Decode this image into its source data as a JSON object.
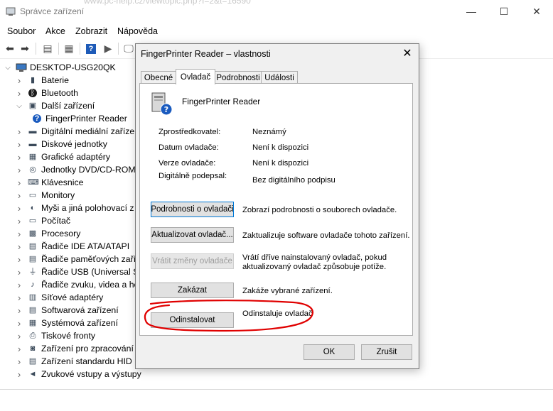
{
  "window": {
    "title": "Správce zařízení",
    "ghost_url": "www.pc-help.cz/viewtopic.php?f=2&t=16590"
  },
  "menu": [
    "Soubor",
    "Akce",
    "Zobrazit",
    "Nápověda"
  ],
  "tree": {
    "root": "DESKTOP-USG20QK",
    "items": [
      {
        "label": "Baterie",
        "icon": "battery-icon",
        "expanded": false
      },
      {
        "label": "Bluetooth",
        "icon": "bluetooth-icon",
        "expanded": false
      },
      {
        "label": "Další zařízení",
        "icon": "other-devices-icon",
        "expanded": true
      },
      {
        "label": "FingerPrinter Reader",
        "icon": "unknown-device-icon",
        "child": true
      },
      {
        "label": "Digitální mediální zaříze",
        "icon": "media-device-icon",
        "expanded": false
      },
      {
        "label": "Diskové jednotky",
        "icon": "disk-drive-icon",
        "expanded": false
      },
      {
        "label": "Grafické adaptéry",
        "icon": "display-adapter-icon",
        "expanded": false
      },
      {
        "label": "Jednotky DVD/CD-ROM",
        "icon": "dvd-drive-icon",
        "expanded": false
      },
      {
        "label": "Klávesnice",
        "icon": "keyboard-icon",
        "expanded": false
      },
      {
        "label": "Monitory",
        "icon": "monitor-icon",
        "expanded": false
      },
      {
        "label": "Myši a jiná polohovací z",
        "icon": "mouse-icon",
        "expanded": false
      },
      {
        "label": "Počítač",
        "icon": "computer-icon",
        "expanded": false
      },
      {
        "label": "Procesory",
        "icon": "processor-icon",
        "expanded": false
      },
      {
        "label": "Řadiče IDE ATA/ATAPI",
        "icon": "ide-controller-icon",
        "expanded": false
      },
      {
        "label": "Řadiče paměťových zaří",
        "icon": "storage-controller-icon",
        "expanded": false
      },
      {
        "label": "Řadiče USB (Universal Se",
        "icon": "usb-icon",
        "expanded": false
      },
      {
        "label": "Řadiče zvuku, videa a he",
        "icon": "sound-icon",
        "expanded": false
      },
      {
        "label": "Síťové adaptéry",
        "icon": "network-adapter-icon",
        "expanded": false
      },
      {
        "label": "Softwarová zařízení",
        "icon": "software-device-icon",
        "expanded": false
      },
      {
        "label": "Systémová zařízení",
        "icon": "system-device-icon",
        "expanded": false
      },
      {
        "label": "Tiskové fronty",
        "icon": "printer-icon",
        "expanded": false
      },
      {
        "label": "Zařízení pro zpracování",
        "icon": "imaging-device-icon",
        "expanded": false
      },
      {
        "label": "Zařízení standardu HID",
        "icon": "hid-icon",
        "expanded": false
      },
      {
        "label": "Zvukové vstupy a výstupy",
        "icon": "speaker-icon",
        "expanded": false
      }
    ]
  },
  "dialog": {
    "title": "FingerPrinter Reader – vlastnosti",
    "tabs": [
      "Obecné",
      "Ovladač",
      "Podrobnosti",
      "Události"
    ],
    "active_tab": "Ovladač",
    "device_name": "FingerPrinter Reader",
    "props": [
      {
        "label": "Zprostředkovatel:",
        "value": "Neznámý"
      },
      {
        "label": "Datum ovladače:",
        "value": "Není k dispozici"
      },
      {
        "label": "Verze ovladače:",
        "value": "Není k dispozici"
      },
      {
        "label": "Digitálně podepsal:",
        "value": "Bez digitálního podpisu"
      }
    ],
    "actions": [
      {
        "button": "Podrobnosti o ovladači",
        "desc": "Zobrazí podrobnosti o souborech ovladače.",
        "disabled": false
      },
      {
        "button": "Aktualizovat ovladač...",
        "desc": "Zaktualizuje software ovladače tohoto zařízení.",
        "disabled": false
      },
      {
        "button": "Vrátit změny ovladače",
        "desc": "Vrátí dříve nainstalovaný ovladač, pokud aktualizovaný ovladač způsobuje potíže.",
        "disabled": true
      },
      {
        "button": "Zakázat",
        "desc": "Zakáže vybrané zařízení.",
        "disabled": false
      },
      {
        "button": "Odinstalovat",
        "desc": "Odinstaluje ovladač",
        "disabled": false
      }
    ],
    "ok": "OK",
    "cancel": "Zrušit"
  },
  "colors": {
    "annotation": "#e00000",
    "focus": "#0078d7"
  }
}
